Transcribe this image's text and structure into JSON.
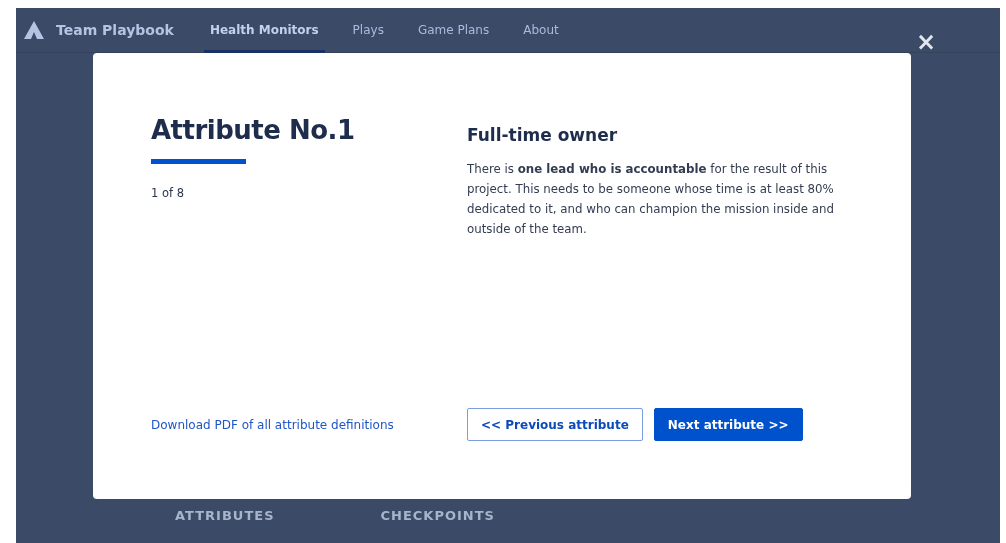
{
  "nav": {
    "brand": "Team Playbook",
    "items": [
      {
        "label": "Health Monitors",
        "selected": true
      },
      {
        "label": "Plays",
        "selected": false
      },
      {
        "label": "Game Plans",
        "selected": false
      },
      {
        "label": "About",
        "selected": false
      }
    ]
  },
  "close": "×",
  "background_tabs": [
    "ATTRIBUTES",
    "CHECKPOINTS"
  ],
  "modal": {
    "title": "Attribute No.1",
    "counter": "1 of 8",
    "heading": "Full-time owner",
    "body": "There is **one lead who is accountable** for the result of this project. This needs to be someone whose time is at least 80% dedicated to it, and who can champion the mission inside and outside of the team.",
    "download_link": "Download PDF of all attribute definitions",
    "buttons": [
      {
        "label": "<< Previous attribute",
        "kind": "secondary"
      },
      {
        "label": "Next attribute >>",
        "kind": "primary"
      }
    ]
  }
}
